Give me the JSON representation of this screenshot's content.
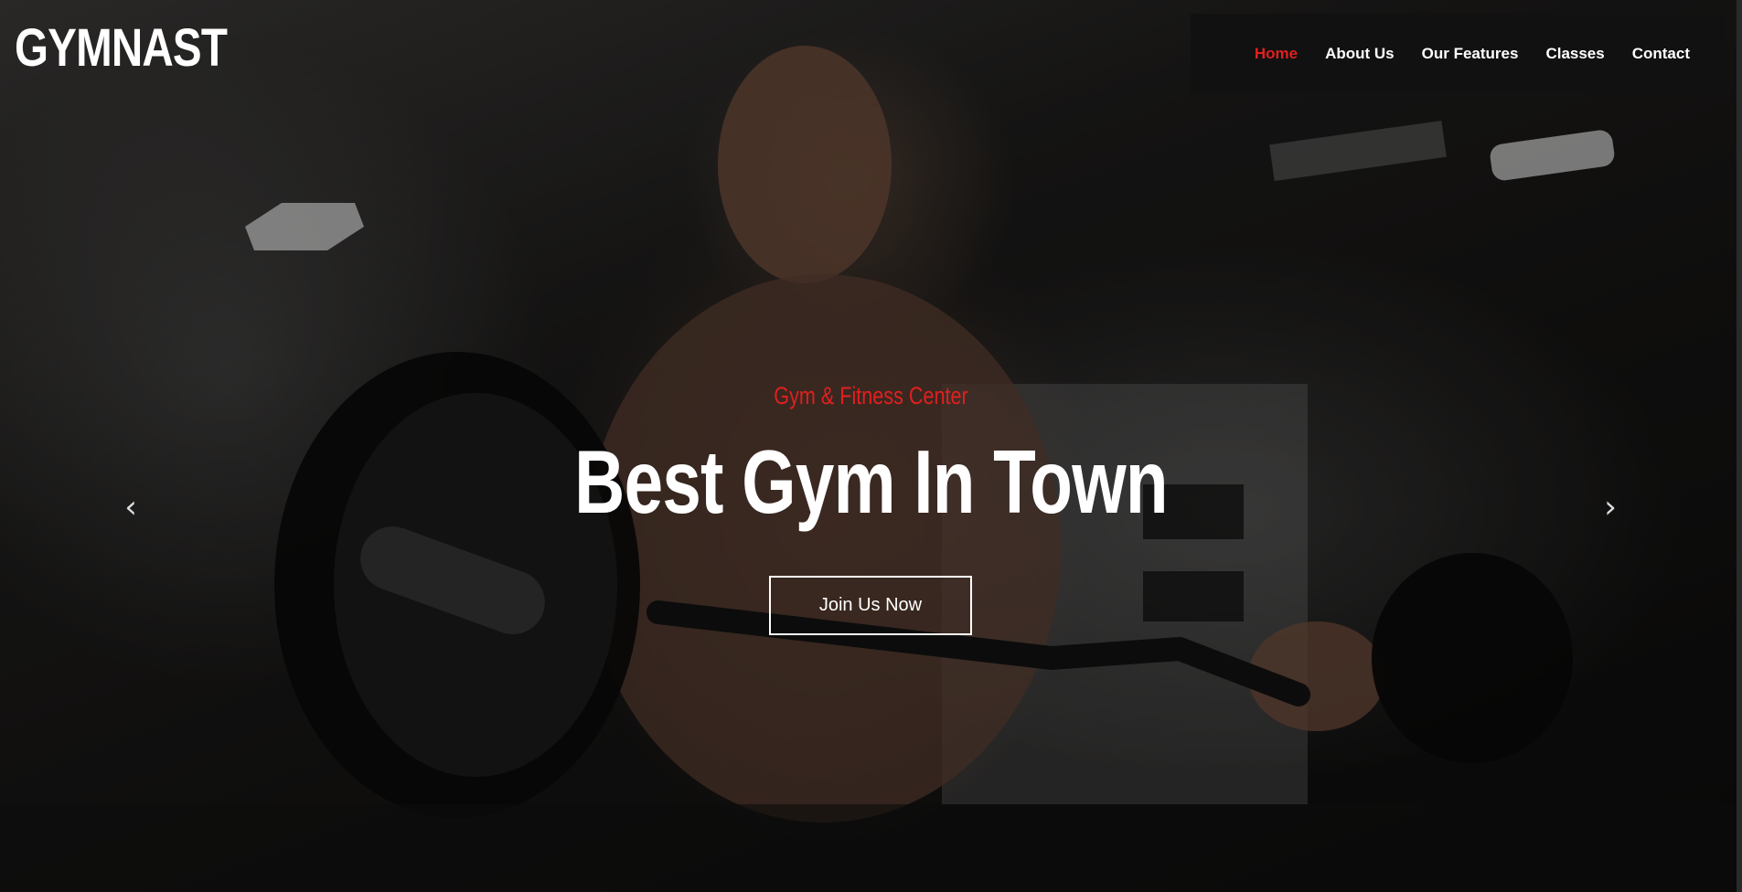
{
  "brand": {
    "name": "GYMNAST"
  },
  "nav": {
    "items": [
      {
        "label": "Home",
        "active": true
      },
      {
        "label": "About Us",
        "active": false
      },
      {
        "label": "Our Features",
        "active": false
      },
      {
        "label": "Classes",
        "active": false
      },
      {
        "label": "Contact",
        "active": false
      }
    ]
  },
  "hero": {
    "subtitle": "Gym & Fitness Center",
    "headline": "Best Gym In Town",
    "cta_label": "Join Us Now",
    "prev_icon": "chevron-left-icon",
    "next_icon": "chevron-right-icon",
    "prev_glyph": "‹",
    "next_glyph": "›"
  },
  "colors": {
    "accent": "#e0201f",
    "nav_background": "#111111",
    "text": "#ffffff"
  }
}
